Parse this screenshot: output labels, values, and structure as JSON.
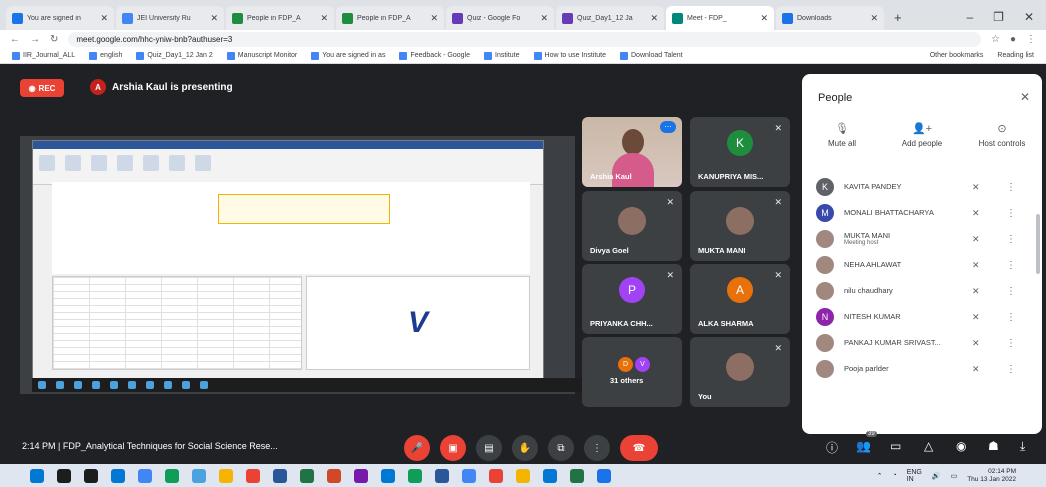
{
  "browser": {
    "tabs": [
      {
        "title": "You are signed in",
        "color": "#1a73e8"
      },
      {
        "title": "JEI University Ru",
        "color": "#4285f4"
      },
      {
        "title": "People in FDP_A",
        "color": "#1e8e3e"
      },
      {
        "title": "People in FDP_A",
        "color": "#1e8e3e"
      },
      {
        "title": "Quiz - Google Fo",
        "color": "#673ab7"
      },
      {
        "title": "Quiz_Day1_12 Ja",
        "color": "#673ab7"
      },
      {
        "title": "Meet - FDP_",
        "color": "#00897b",
        "active": true
      },
      {
        "title": "Downloads",
        "color": "#1a73e8"
      }
    ],
    "url": "meet.google.com/hhc-yniw-bnb?authuser=3",
    "bookmarks": [
      "IIR_Journal_ALL",
      "english",
      "Quiz_Day1_12 Jan 2",
      "Manuscript Monitor",
      "You are signed in as",
      "Feedback - Google",
      "Institute",
      "How to use Institute",
      "Download Talent"
    ],
    "bookmarks_right": [
      "Other bookmarks",
      "Reading list"
    ]
  },
  "meet": {
    "rec_label": "REC",
    "presenter_initial": "A",
    "presenter_text": "Arshia Kaul is presenting",
    "tiles": [
      {
        "name": "Arshia Kaul",
        "type": "video"
      },
      {
        "name": "KANUPRIYA MIS...",
        "initial": "K",
        "color": "#1e8e3e"
      },
      {
        "name": "Divya Goel",
        "type": "photo"
      },
      {
        "name": "MUKTA MANI",
        "type": "photo"
      },
      {
        "name": "PRIYANKA CHH...",
        "initial": "P",
        "color": "#a142f4"
      },
      {
        "name": "ALKA SHARMA",
        "initial": "A",
        "color": "#e8710a"
      },
      {
        "name": "31 others",
        "type": "others",
        "initials": [
          "D",
          "V"
        ],
        "colors": [
          "#e8710a",
          "#a142f4"
        ]
      },
      {
        "name": "You",
        "type": "photo"
      }
    ],
    "meeting_info": "2:14 PM  |  FDP_Analytical Techniques for Social Science Rese...",
    "participant_count": "39"
  },
  "panel": {
    "title": "People",
    "mute_all": "Mute all",
    "add_people": "Add people",
    "host_controls": "Host controls",
    "people": [
      {
        "name": "KAVITA PANDEY",
        "initial": "K",
        "color": "#5f6368"
      },
      {
        "name": "MONALI BHATTACHARYA",
        "initial": "M",
        "color": "#3949ab"
      },
      {
        "name": "MUKTA MANI",
        "sub": "Meeting host",
        "photo": true
      },
      {
        "name": "NEHA AHLAWAT",
        "photo": true
      },
      {
        "name": "nilu chaudhary",
        "photo": true
      },
      {
        "name": "NITESH KUMAR",
        "initial": "N",
        "color": "#8e24aa"
      },
      {
        "name": "PANKAJ KUMAR SRIVAST...",
        "photo": true
      },
      {
        "name": "Pooja parlder",
        "photo": true
      }
    ]
  },
  "taskbar": {
    "lang": "ENG",
    "region": "IN",
    "time": "02:14 PM",
    "date": "Thu 13 Jan 2022"
  }
}
